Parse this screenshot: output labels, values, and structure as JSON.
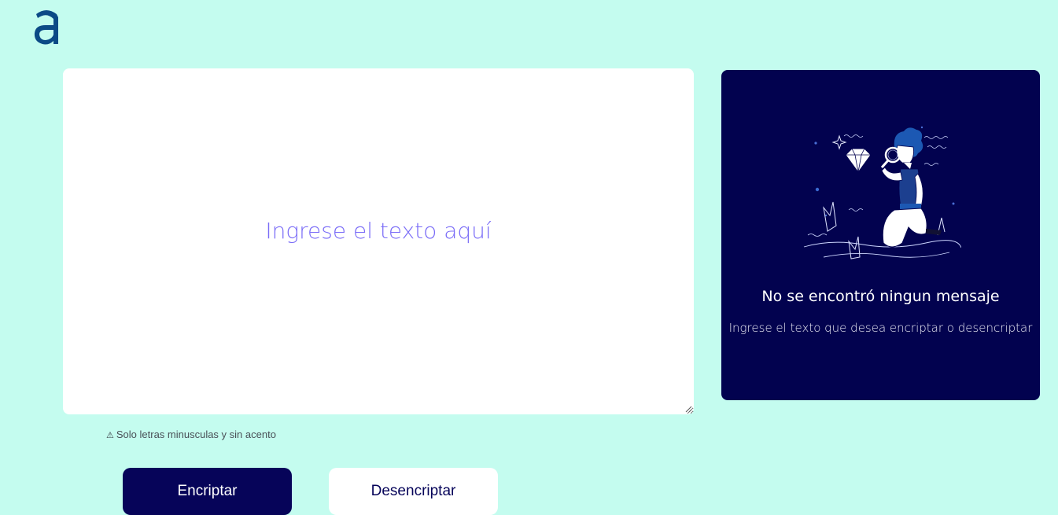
{
  "header": {
    "logo_icon": "alura-logo-icon"
  },
  "input": {
    "placeholder": "Ingrese el texto aquí",
    "value": ""
  },
  "hint": {
    "icon": "warning-icon",
    "symbol": "⚠",
    "text": "Solo letras minusculas y sin acento"
  },
  "buttons": {
    "encrypt_label": "Encriptar",
    "decrypt_label": "Desencriptar"
  },
  "output": {
    "illustration": "person-inspecting-diamond-illustration",
    "title": "No se encontró ningun mensaje",
    "subtitle": "Ingrese el texto que desea encriptar o desencriptar"
  },
  "colors": {
    "background": "#c4fcef",
    "primary": "#060459",
    "panel": "#02024f",
    "placeholder": "#6d5cf5"
  }
}
